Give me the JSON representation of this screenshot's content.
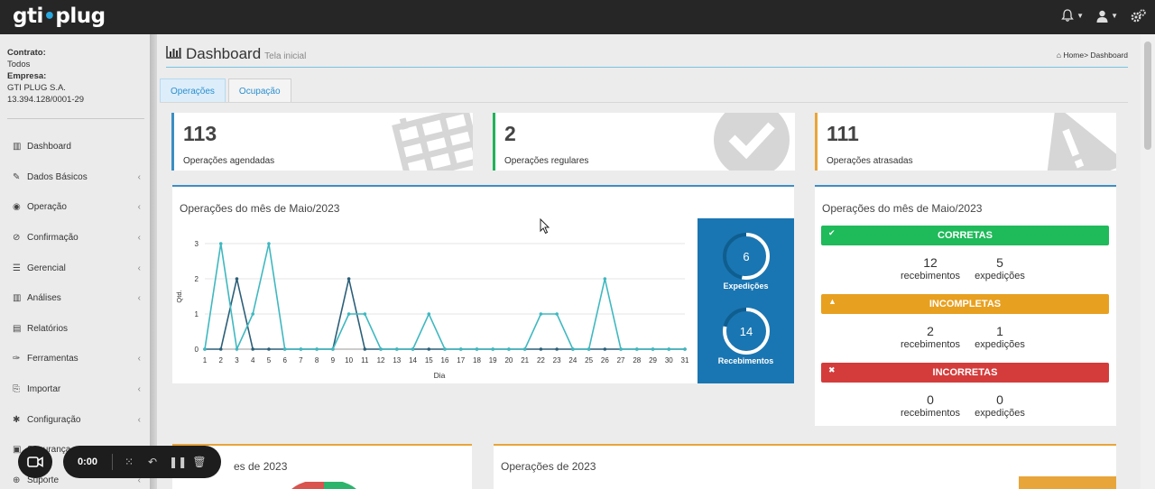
{
  "app": {
    "logo_left": "gti",
    "logo_dot": "•",
    "logo_right": "plug"
  },
  "topbar": {
    "icons": [
      "bell-icon",
      "user-icon",
      "settings-icon"
    ]
  },
  "sidebar": {
    "contract_label": "Contrato:",
    "contract_value": "Todos",
    "company_label": "Empresa:",
    "company_name": "GTI PLUG S.A.",
    "company_id": "13.394.128/0001-29",
    "items": [
      {
        "label": "Dashboard",
        "icon": "bar-chart-icon",
        "chevron": false
      },
      {
        "label": "Dados Básicos",
        "icon": "edit-icon",
        "chevron": true
      },
      {
        "label": "Operação",
        "icon": "circle-dot-icon",
        "chevron": true
      },
      {
        "label": "Confirmação",
        "icon": "check-circle-icon",
        "chevron": true
      },
      {
        "label": "Gerencial",
        "icon": "list-icon",
        "chevron": true
      },
      {
        "label": "Análises",
        "icon": "bar-chart-icon",
        "chevron": true
      },
      {
        "label": "Relatórios",
        "icon": "file-icon",
        "chevron": false
      },
      {
        "label": "Ferramentas",
        "icon": "wrench-icon",
        "chevron": true
      },
      {
        "label": "Importar",
        "icon": "import-icon",
        "chevron": true
      },
      {
        "label": "Configuração",
        "icon": "gear-icon",
        "chevron": true
      },
      {
        "label": "Segurança",
        "icon": "lock-icon",
        "chevron": true
      },
      {
        "label": "Suporte",
        "icon": "lifebuoy-icon",
        "chevron": true
      }
    ]
  },
  "header": {
    "title": "Dashboard",
    "subtitle": "Tela inicial",
    "breadcrumb_home": "Home",
    "breadcrumb_current": "> Dashboard"
  },
  "tabs": [
    {
      "label": "Operações",
      "active": true
    },
    {
      "label": "Ocupação",
      "active": false
    }
  ],
  "stats": [
    {
      "value": "113",
      "label": "Operações agendadas",
      "color": "#3b8ec4"
    },
    {
      "value": "2",
      "label": "Operações regulares",
      "color": "#1fb35a"
    },
    {
      "value": "111",
      "label": "Operações atrasadas",
      "color": "#e8a53a"
    }
  ],
  "monthly_panel": {
    "title": "Operações do mês de Maio/2023",
    "expedicoes_value": "6",
    "expedicoes_label": "Expedições",
    "recebimentos_value": "14",
    "recebimentos_label": "Recebimentos"
  },
  "chart_data": {
    "type": "line",
    "xlabel": "Dia",
    "ylabel": "Qtd.",
    "ylim": [
      0,
      3
    ],
    "yticks": [
      0,
      1,
      2,
      3
    ],
    "x": [
      1,
      2,
      3,
      4,
      5,
      6,
      7,
      8,
      9,
      10,
      11,
      12,
      13,
      14,
      15,
      16,
      17,
      18,
      19,
      20,
      21,
      22,
      23,
      24,
      25,
      26,
      27,
      28,
      29,
      30,
      31
    ],
    "series": [
      {
        "color": "#2c5f78",
        "values": [
          0,
          0,
          2,
          0,
          0,
          0,
          0,
          0,
          0,
          2,
          0,
          0,
          0,
          0,
          0,
          0,
          0,
          0,
          0,
          0,
          0,
          0,
          0,
          0,
          0,
          0,
          0,
          0,
          0,
          0,
          0
        ]
      },
      {
        "color": "#3fb8c0",
        "values": [
          0,
          3,
          0,
          1,
          3,
          0,
          0,
          0,
          0,
          1,
          1,
          0,
          0,
          0,
          1,
          0,
          0,
          0,
          0,
          0,
          0,
          1,
          1,
          0,
          0,
          2,
          0,
          0,
          0,
          0,
          0
        ]
      }
    ],
    "grid": true
  },
  "status_panel": {
    "title": "Operações do mês de Maio/2023",
    "rows": [
      {
        "label": "CORRETAS",
        "icon": "check-icon",
        "color": "#1fba5a",
        "recebimentos": "12",
        "expedicoes": "5"
      },
      {
        "label": "INCOMPLETAS",
        "icon": "warning-icon",
        "color": "#e8a020",
        "recebimentos": "2",
        "expedicoes": "1"
      },
      {
        "label": "INCORRETAS",
        "icon": "close-icon",
        "color": "#d43c3c",
        "recebimentos": "0",
        "expedicoes": "0"
      }
    ],
    "recebimentos_label": "recebimentos",
    "expedicoes_label": "expedições"
  },
  "bottom": {
    "left_title": "es de 2023",
    "right_title": "Operações de 2023"
  },
  "recorder": {
    "time": "0:00"
  }
}
